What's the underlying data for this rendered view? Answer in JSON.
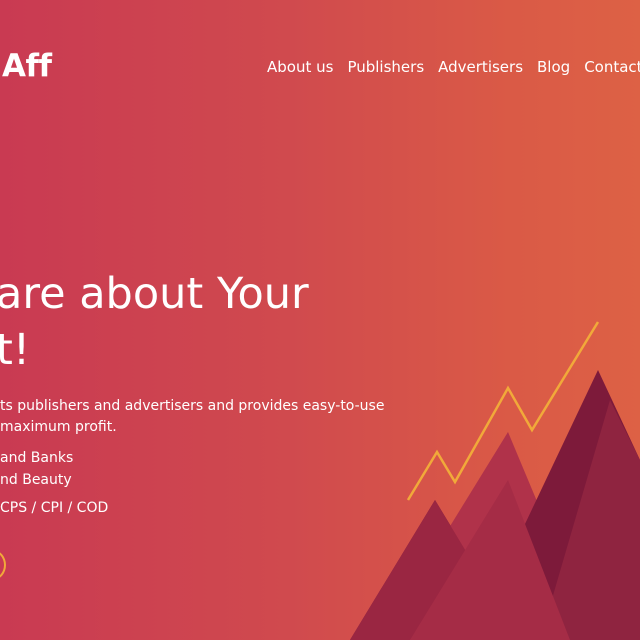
{
  "header": {
    "logo_text": "Aff",
    "nav": [
      {
        "label": "About us"
      },
      {
        "label": "Publishers"
      },
      {
        "label": "Advertisers"
      },
      {
        "label": "Blog"
      },
      {
        "label": "Contact"
      }
    ]
  },
  "hero": {
    "headline_line1": "are about Your",
    "headline_line2": "t!",
    "description_line1": "ts publishers and advertisers and provides easy-to-use",
    "description_line2": " maximum profit.",
    "features": [
      "and Banks",
      "nd Beauty",
      "CPS / CPI / COD"
    ]
  },
  "theme": {
    "gradient_start": "#c93a52",
    "gradient_end": "#dd6145",
    "accent_line": "#f1a93a",
    "mountain_dark": "#7d1a3a",
    "mountain_mid": "#8f2440",
    "mountain_light": "#b0324a"
  }
}
